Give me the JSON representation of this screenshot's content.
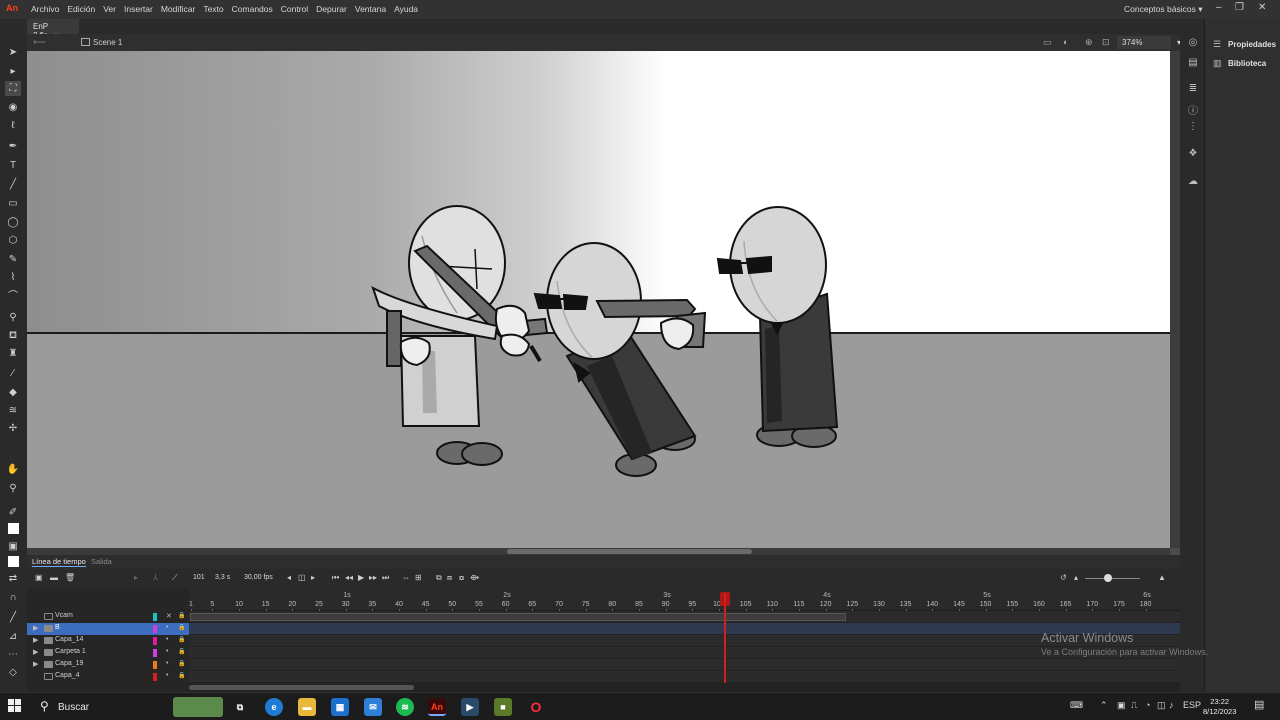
{
  "app": {
    "logo": "An",
    "menu": [
      "Archivo",
      "Edición",
      "Ver",
      "Insertar",
      "Modificar",
      "Texto",
      "Comandos",
      "Control",
      "Depurar",
      "Ventana",
      "Ayuda"
    ],
    "workspace": "Conceptos básicos",
    "accent": "#ff3c1a"
  },
  "document": {
    "tab_label": "EnP 2.fla",
    "scene": "Scene 1",
    "zoom": "374%"
  },
  "right_panel": {
    "properties": "Propiedades",
    "library": "Biblioteca"
  },
  "timeline": {
    "tabs": [
      "Línea de tiempo",
      "Salida"
    ],
    "current_frame": "101",
    "time": "3,3 s",
    "fps": "30,00 fps",
    "seconds": [
      "1s",
      "2s",
      "3s",
      "4s",
      "5s",
      "6s"
    ],
    "frame_numbers": [
      "1",
      "5",
      "10",
      "15",
      "20",
      "25",
      "30",
      "35",
      "40",
      "45",
      "50",
      "55",
      "60",
      "65",
      "70",
      "75",
      "80",
      "85",
      "90",
      "95",
      "100",
      "105",
      "110",
      "115",
      "120",
      "125",
      "130",
      "135",
      "140",
      "145",
      "150",
      "155",
      "160",
      "165",
      "170",
      "175",
      "180"
    ],
    "layers": [
      {
        "name": "Vcam",
        "color": "#19c4c4",
        "selected": false,
        "folder": false
      },
      {
        "name": "B",
        "color": "#d23ce0",
        "selected": true,
        "folder": true
      },
      {
        "name": "Capa_14",
        "color": "#e0199e",
        "selected": false,
        "folder": true
      },
      {
        "name": "Carpeta 1",
        "color": "#d23ce0",
        "selected": false,
        "folder": true
      },
      {
        "name": "Capa_19",
        "color": "#f07a1e",
        "selected": false,
        "folder": true
      },
      {
        "name": "Capa_4",
        "color": "#d42020",
        "selected": false,
        "folder": false
      }
    ]
  },
  "watermark": {
    "title": "Activar Windows",
    "subtitle": "Ve a Configuración para activar Windows."
  },
  "taskbar": {
    "search": "Buscar",
    "lang": "ESP",
    "time": "23:22",
    "date": "8/12/2023"
  }
}
